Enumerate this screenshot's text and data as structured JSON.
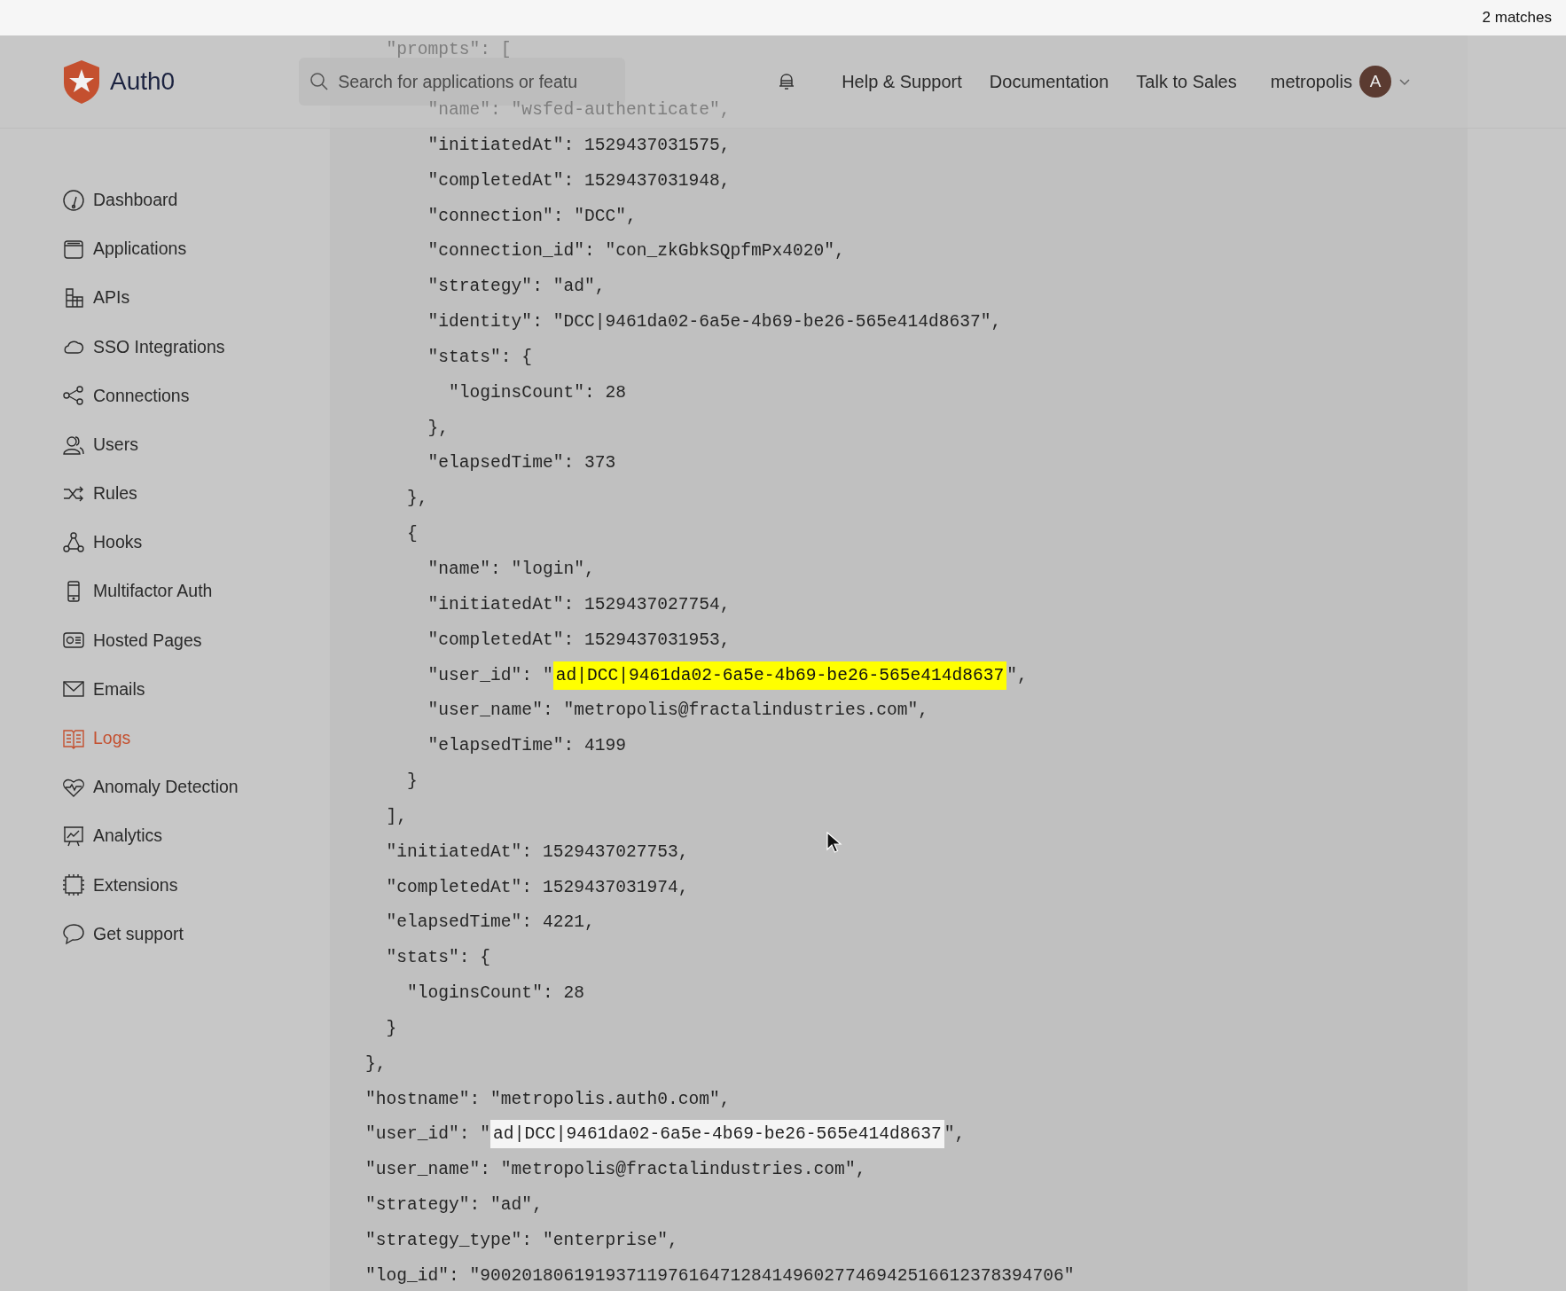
{
  "find_bar": {
    "matches": "2 matches"
  },
  "header": {
    "brand": "Auth0",
    "search": {
      "placeholder": "Search for applications or featu"
    },
    "links": [
      "Help & Support",
      "Documentation",
      "Talk to Sales"
    ],
    "user": {
      "name": "metropolis",
      "avatar": "A"
    }
  },
  "sidebar": {
    "items": [
      {
        "label": "Dashboard",
        "selected": false
      },
      {
        "label": "Applications",
        "selected": false
      },
      {
        "label": "APIs",
        "selected": false
      },
      {
        "label": "SSO Integrations",
        "selected": false
      },
      {
        "label": "Connections",
        "selected": false
      },
      {
        "label": "Users",
        "selected": false
      },
      {
        "label": "Rules",
        "selected": false
      },
      {
        "label": "Hooks",
        "selected": false
      },
      {
        "label": "Multifactor Auth",
        "selected": false
      },
      {
        "label": "Hosted Pages",
        "selected": false
      },
      {
        "label": "Emails",
        "selected": false
      },
      {
        "label": "Logs",
        "selected": true
      },
      {
        "label": "Anomaly Detection",
        "selected": false
      },
      {
        "label": "Analytics",
        "selected": false
      },
      {
        "label": "Extensions",
        "selected": false
      },
      {
        "label": "Get support",
        "selected": false
      }
    ]
  },
  "code_lines": [
    {
      "kind": "faded",
      "text": "  \"prompts\": ["
    },
    {
      "kind": "faded",
      "text": "      \"name\": \"wsfed-authenticate\","
    },
    {
      "kind": "code",
      "text": "      \"initiatedAt\": 1529437031575,"
    },
    {
      "kind": "code",
      "text": "      \"completedAt\": 1529437031948,"
    },
    {
      "kind": "code",
      "text": "      \"connection\": \"DCC\","
    },
    {
      "kind": "code",
      "text": "      \"connection_id\": \"con_zkGbkSQpfmPx4020\","
    },
    {
      "kind": "code",
      "text": "      \"strategy\": \"ad\","
    },
    {
      "kind": "code",
      "text": "      \"identity\": \"DCC|9461da02-6a5e-4b69-be26-565e414d8637\","
    },
    {
      "kind": "code",
      "text": "      \"stats\": {"
    },
    {
      "kind": "code",
      "text": "        \"loginsCount\": 28"
    },
    {
      "kind": "code",
      "text": "      },"
    },
    {
      "kind": "code",
      "text": "      \"elapsedTime\": 373"
    },
    {
      "kind": "code",
      "text": "    },"
    },
    {
      "kind": "code",
      "text": "    {"
    },
    {
      "kind": "code",
      "text": "      \"name\": \"login\","
    },
    {
      "kind": "code",
      "text": "      \"initiatedAt\": 1529437027754,"
    },
    {
      "kind": "code",
      "text": "      \"completedAt\": 1529437031953,"
    },
    {
      "kind": "match",
      "text": "      \"user_id\": \"",
      "match": "ad|DCC|9461da02-6a5e-4b69-be26-565e414d8637",
      "after": "\",",
      "selected": true
    },
    {
      "kind": "code",
      "text": "      \"user_name\": \"metropolis@fractalindustries.com\","
    },
    {
      "kind": "code",
      "text": "      \"elapsedTime\": 4199"
    },
    {
      "kind": "code",
      "text": "    }"
    },
    {
      "kind": "code",
      "text": "  ],"
    },
    {
      "kind": "code",
      "text": "  \"initiatedAt\": 1529437027753,"
    },
    {
      "kind": "code",
      "text": "  \"completedAt\": 1529437031974,"
    },
    {
      "kind": "code",
      "text": "  \"elapsedTime\": 4221,"
    },
    {
      "kind": "code",
      "text": "  \"stats\": {"
    },
    {
      "kind": "code",
      "text": "    \"loginsCount\": 28"
    },
    {
      "kind": "code",
      "text": "  }"
    },
    {
      "kind": "code",
      "text": "},"
    },
    {
      "kind": "code",
      "text": "\"hostname\": \"metropolis.auth0.com\","
    },
    {
      "kind": "match",
      "text": "\"user_id\": \"",
      "match": "ad|DCC|9461da02-6a5e-4b69-be26-565e414d8637",
      "after": "\",",
      "selected": false
    },
    {
      "kind": "code",
      "text": "\"user_name\": \"metropolis@fractalindustries.com\","
    },
    {
      "kind": "code",
      "text": "\"strategy\": \"ad\","
    },
    {
      "kind": "code",
      "text": "\"strategy_type\": \"enterprise\","
    },
    {
      "kind": "code",
      "text": "\"log_id\": \"90020180619193711976164712841496027746942516612378394706\""
    }
  ]
}
